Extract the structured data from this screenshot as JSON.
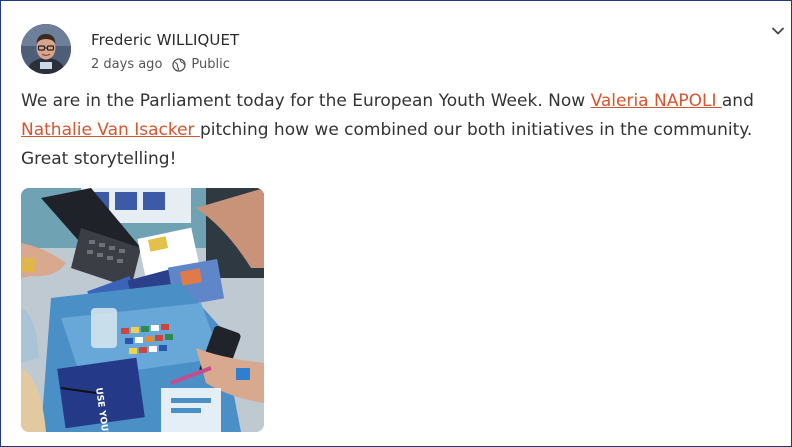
{
  "post": {
    "author": {
      "name": "Frederic WILLIQUET",
      "avatar_icon": "person-avatar"
    },
    "timestamp": "2 days ago",
    "visibility": "Public",
    "visibility_icon": "globe-icon",
    "menu_icon": "chevron-down-icon",
    "body": {
      "line1_text": "We are in the Parliament today for the European Youth Week. Now ",
      "mention1": "Valeria NAPOLI ",
      "line1_after": "and",
      "mention2": "Nathalie Van Isacker ",
      "line2_after": "pitching how we combined our both initiatives in the community.",
      "line3": "Great storytelling!"
    },
    "image": {
      "description_icon": "photo",
      "book_text": "USE YOUR VOTE"
    },
    "colors": {
      "mention": "#d4552e",
      "border": "#1f3a7a"
    }
  }
}
